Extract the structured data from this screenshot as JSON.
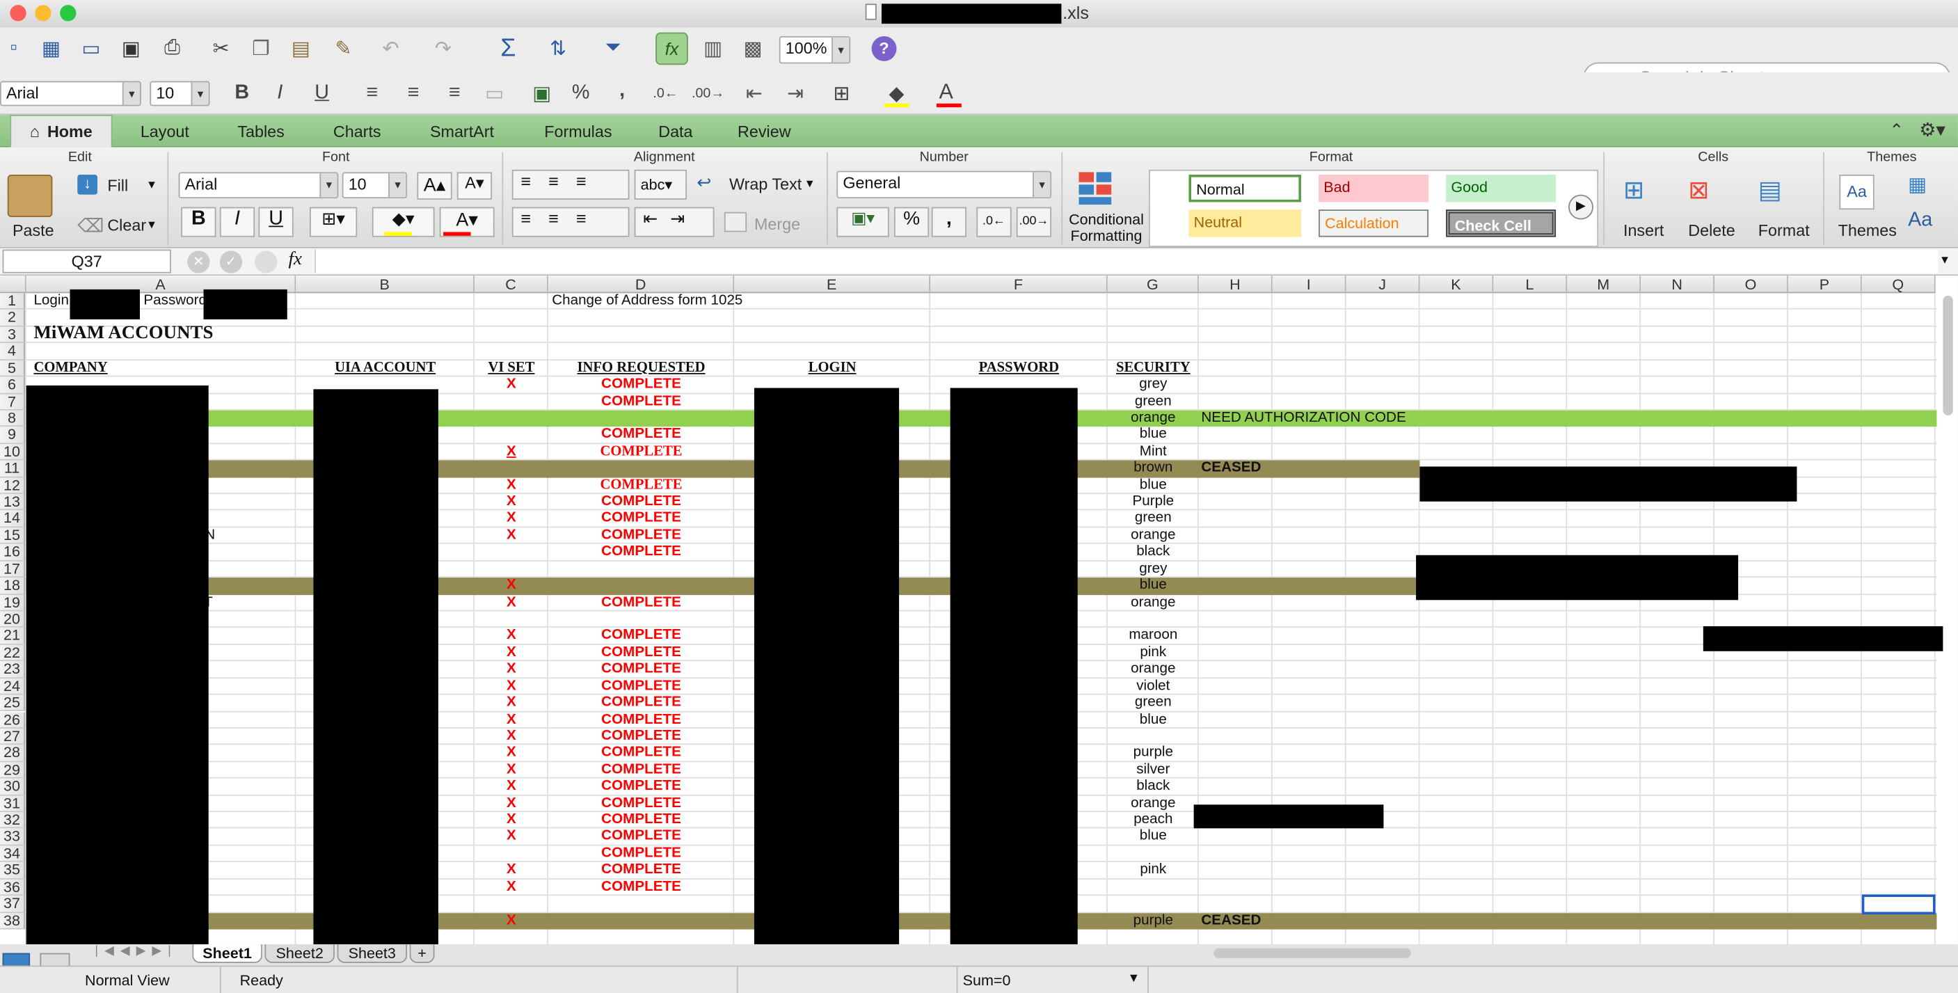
{
  "window": {
    "filename_suffix": ".xls"
  },
  "toolbar": {
    "zoom": "100%",
    "search_placeholder": "Search in Sheet",
    "help": "?",
    "fx": "fx"
  },
  "format_bar": {
    "font": "Arial",
    "size": "10",
    "bold": "B",
    "italic": "I",
    "underline": "U",
    "percent": "%",
    "comma": ","
  },
  "ribbon_tabs": [
    "Home",
    "Layout",
    "Tables",
    "Charts",
    "SmartArt",
    "Formulas",
    "Data",
    "Review"
  ],
  "ribbon": {
    "groups": {
      "edit": "Edit",
      "font": "Font",
      "alignment": "Alignment",
      "number": "Number",
      "format": "Format",
      "cells": "Cells",
      "themes": "Themes"
    },
    "paste": "Paste",
    "fill": "Fill",
    "clear": "Clear",
    "font": "Arial",
    "size": "10",
    "bold": "B",
    "italic": "I",
    "underline": "U",
    "wrap_text": "Wrap Text",
    "merge": "Merge",
    "abc": "abc",
    "number_format": "General",
    "percent": "%",
    "comma": ",",
    "conditional_formatting": "Conditional Formatting",
    "styles": {
      "normal": "Normal",
      "bad": "Bad",
      "good": "Good",
      "neutral": "Neutral",
      "calculation": "Calculation",
      "check_cell": "Check Cell"
    },
    "insert": "Insert",
    "delete": "Delete",
    "format": "Format",
    "themes": "Themes",
    "aa": "Aa"
  },
  "formula_bar": {
    "cell_ref": "Q37",
    "fx": "fx",
    "content": ""
  },
  "columns": [
    "A",
    "B",
    "C",
    "D",
    "E",
    "F",
    "G",
    "H",
    "I",
    "J",
    "K",
    "L",
    "M",
    "N",
    "O",
    "P",
    "Q"
  ],
  "rows": [
    "1",
    "2",
    "3",
    "4",
    "5",
    "6",
    "7",
    "8",
    "9",
    "10",
    "11",
    "12",
    "13",
    "14",
    "15",
    "16",
    "17",
    "18",
    "19",
    "20",
    "21",
    "22",
    "23",
    "24",
    "25",
    "26",
    "27",
    "28",
    "29",
    "30",
    "31",
    "32",
    "33",
    "34",
    "35",
    "36",
    "37",
    "38"
  ],
  "sheet": {
    "r1": {
      "login": "Login",
      "password": "Password",
      "d1": "Change of Address form 1025"
    },
    "title": "MiWAM ACCOUNTS",
    "headers": {
      "company": "COMPANY",
      "uia": "UIA ACCOUNT",
      "vi": "VI SET",
      "info": "INFO REQUESTED",
      "login": "LOGIN",
      "password": "PASSWORD",
      "security": "SECURITY"
    },
    "a_fragments": [
      {
        "row": "15",
        "text": "ON"
      },
      {
        "row": "19",
        "text": "NT"
      }
    ],
    "data_rows": [
      {
        "row": "6",
        "vi": "X",
        "info": "COMPLETE",
        "sec": "grey",
        "note": ""
      },
      {
        "row": "7",
        "vi": "",
        "info": "COMPLETE",
        "sec": "green",
        "note": ""
      },
      {
        "row": "8",
        "vi": "",
        "info": "",
        "sec": "orange",
        "note": "NEED AUTHORIZATION CODE"
      },
      {
        "row": "9",
        "vi": "",
        "info": "COMPLETE",
        "sec": "blue",
        "note": ""
      },
      {
        "row": "10",
        "vi": "X",
        "info": "COMPLETE",
        "sec": "Mint",
        "note": ""
      },
      {
        "row": "11",
        "vi": "",
        "info": "",
        "sec": "brown",
        "note": "CEASED"
      },
      {
        "row": "12",
        "vi": "X",
        "info": "COMPLETE",
        "sec": "blue",
        "note": ""
      },
      {
        "row": "13",
        "vi": "X",
        "info": "COMPLETE",
        "sec": "Purple",
        "note": ""
      },
      {
        "row": "14",
        "vi": "X",
        "info": "COMPLETE",
        "sec": "green",
        "note": ""
      },
      {
        "row": "15",
        "vi": "X",
        "info": "COMPLETE",
        "sec": "orange",
        "note": ""
      },
      {
        "row": "16",
        "vi": "",
        "info": "COMPLETE",
        "sec": "black",
        "note": ""
      },
      {
        "row": "17",
        "vi": "",
        "info": "",
        "sec": "grey",
        "note": ""
      },
      {
        "row": "18",
        "vi": "X",
        "info": "",
        "sec": "blue",
        "note": ""
      },
      {
        "row": "19",
        "vi": "X",
        "info": "COMPLETE",
        "sec": "orange",
        "note": ""
      },
      {
        "row": "20",
        "vi": "",
        "info": "",
        "sec": "",
        "note": ""
      },
      {
        "row": "21",
        "vi": "X",
        "info": "COMPLETE",
        "sec": "maroon",
        "note": ""
      },
      {
        "row": "22",
        "vi": "X",
        "info": "COMPLETE",
        "sec": "pink",
        "note": ""
      },
      {
        "row": "23",
        "vi": "X",
        "info": "COMPLETE",
        "sec": "orange",
        "note": ""
      },
      {
        "row": "24",
        "vi": "X",
        "info": "COMPLETE",
        "sec": "violet",
        "note": ""
      },
      {
        "row": "25",
        "vi": "X",
        "info": "COMPLETE",
        "sec": "green",
        "note": ""
      },
      {
        "row": "26",
        "vi": "X",
        "info": "COMPLETE",
        "sec": "blue",
        "note": ""
      },
      {
        "row": "27",
        "vi": "X",
        "info": "COMPLETE",
        "sec": "",
        "note": ""
      },
      {
        "row": "28",
        "vi": "X",
        "info": "COMPLETE",
        "sec": "purple",
        "note": ""
      },
      {
        "row": "29",
        "vi": "X",
        "info": "COMPLETE",
        "sec": "silver",
        "note": ""
      },
      {
        "row": "30",
        "vi": "X",
        "info": "COMPLETE",
        "sec": "black",
        "note": ""
      },
      {
        "row": "31",
        "vi": "X",
        "info": "COMPLETE",
        "sec": "orange",
        "note": ""
      },
      {
        "row": "32",
        "vi": "X",
        "info": "COMPLETE",
        "sec": "peach",
        "note": ""
      },
      {
        "row": "33",
        "vi": "X",
        "info": "COMPLETE",
        "sec": "blue",
        "note": ""
      },
      {
        "row": "34",
        "vi": "",
        "info": "COMPLETE",
        "sec": "",
        "note": ""
      },
      {
        "row": "35",
        "vi": "X",
        "info": "COMPLETE",
        "sec": "pink",
        "note": ""
      },
      {
        "row": "36",
        "vi": "X",
        "info": "COMPLETE",
        "sec": "",
        "note": ""
      },
      {
        "row": "37",
        "vi": "",
        "info": "",
        "sec": "",
        "note": ""
      },
      {
        "row": "38",
        "vi": "X",
        "info": "",
        "sec": "purple",
        "note": "CEASED"
      }
    ]
  },
  "colors": {
    "green_band": "#92d050",
    "olive_band": "#948a54",
    "red_text": "#ff0000",
    "ribbon_green": "#9ccf93",
    "selection": "#1f5fc7"
  },
  "sheet_tabs": [
    "Sheet1",
    "Sheet2",
    "Sheet3"
  ],
  "status": {
    "view": "Normal View",
    "ready": "Ready",
    "sum": "Sum=0"
  }
}
